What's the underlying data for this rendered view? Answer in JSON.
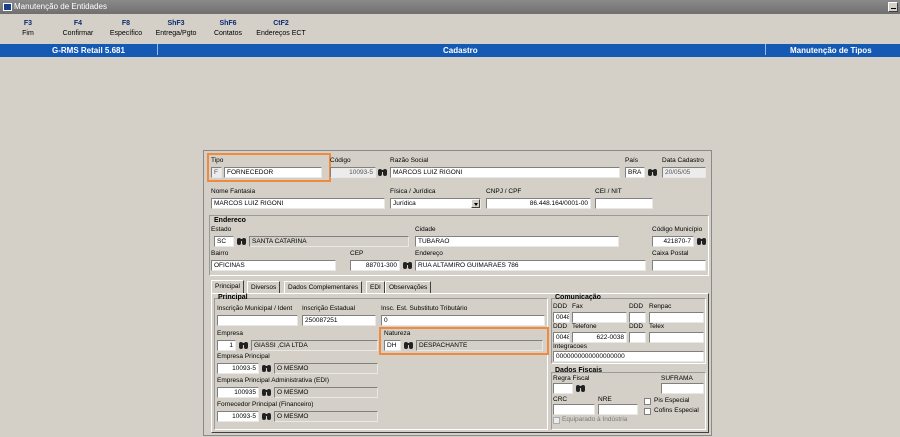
{
  "window": {
    "title": "Manutenção de Entidades"
  },
  "toolbar": {
    "keys": [
      {
        "key": "F3",
        "label": "Fim"
      },
      {
        "key": "F4",
        "label": "Confirmar"
      },
      {
        "key": "F8",
        "label": "Específico"
      },
      {
        "key": "ShF3",
        "label": "Entrega/Pgto"
      },
      {
        "key": "ShF6",
        "label": "Contatos"
      },
      {
        "key": "CtF2",
        "label": "Endereços ECT"
      }
    ]
  },
  "header": {
    "app": "G-RMS Retail 5.681",
    "section": "Cadastro",
    "module": "Manutenção de Tipos"
  },
  "form": {
    "tipo_label": "Tipo",
    "tipo_code": "F",
    "tipo_value": "FORNECEDOR",
    "codigo_label": "Código",
    "codigo_value": "10093-5",
    "razao_label": "Razão Social",
    "razao_value": "MARCOS LUIZ RIGONI",
    "pais_label": "País",
    "pais_value": "BRA",
    "data_label": "Data Cadastro",
    "data_value": "20/05/05",
    "fantasia_label": "Nome Fantasia",
    "fantasia_value": "MARCOS LUIZ RIGONI",
    "fisjur_label": "Física / Jurídica",
    "fisjur_value": "Jurídica",
    "cnpj_label": "CNPJ / CPF",
    "cnpj_value": "86.448.164/0001-00",
    "cei_label": "CEI / NIT",
    "cei_value": "",
    "endereco_title": "Endereco",
    "estado_label": "Estado",
    "estado_code": "SC",
    "estado_value": "SANTA CATARINA",
    "cidade_label": "Cidade",
    "cidade_value": "TUBARAO",
    "codmun_label": "Código Município",
    "codmun_value": "421870-7",
    "bairro_label": "Bairro",
    "bairro_value": "OFICINAS",
    "cep_label": "CEP",
    "cep_value": "88701-300",
    "endereco_label": "Endereço",
    "endereco_value": "RUA ALTAMIRO GUIMARAES 786",
    "caixa_label": "Caixa Postal",
    "caixa_value": "",
    "tabs": [
      "Principal",
      "Diversos",
      "Dados Complementares",
      "EDI",
      "Observações"
    ],
    "principal_title": "Principal",
    "inscmun_label": "Inscrição Municipal / Ident",
    "inscmun_value": "",
    "inscest_label": "Inscrição Estadual",
    "inscest_value": "250087251",
    "inscsub_label": "Insc. Est. Substituto Tributário",
    "inscsub_value": "0",
    "empresa_label": "Empresa",
    "empresa_code": "1",
    "empresa_value": "GIASSI ,CIA LTDA",
    "natureza_label": "Natureza",
    "natureza_code": "DH",
    "natureza_value": "DESPACHANTE",
    "emppri_label": "Empresa Principal",
    "emppri_code": "10093-5",
    "emppri_value": "O MESMO",
    "empadm_label": "Empresa Principal Administrativa (EDI)",
    "empadm_code": "100935",
    "empadm_value": "O MESMO",
    "fornpri_label": "Fornecedor Principal (Financeiro)",
    "fornpri_code": "10093-5",
    "fornpri_value": "O MESMO",
    "comunicacao_title": "Comunicação",
    "ddd_label": "DDD",
    "fax_label": "Fax",
    "renpac_label": "Renpac",
    "ddd1_value": "0048",
    "fax_value": "",
    "ddd2_value": "",
    "renpac_value": "",
    "telefone_label": "Telefone",
    "telex_label": "Telex",
    "ddd3_value": "0048",
    "telefone_value": "622-0038",
    "ddd4_value": "",
    "telex_value": "",
    "integracoes_label": "Integracoes",
    "integracoes_value": "0000000000000000000",
    "fiscais_title": "Dados Fiscais",
    "regra_label": "Regra Fiscal",
    "regra_value": "",
    "suframa_label": "SUFRAMA",
    "suframa_value": "",
    "crc_label": "CRC",
    "crc_value": "",
    "nre_label": "NRE",
    "nre_value": "",
    "pis_label": "Pis Especial",
    "cofins_label": "Cofins Especial",
    "equip_label": "Equiparado à Indústria"
  }
}
